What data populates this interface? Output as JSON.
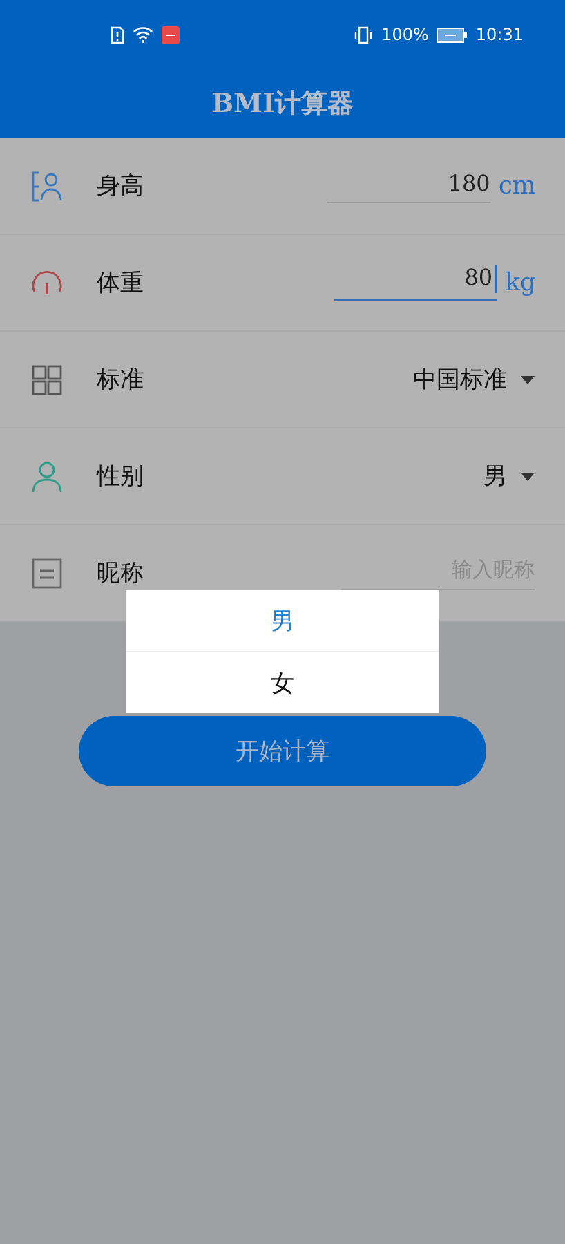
{
  "status_bar": {
    "battery": "100%",
    "time": "10:31"
  },
  "title": "BMI计算器",
  "rows": [
    {
      "kind": "input",
      "label": "身高",
      "value": "180",
      "unit": "cm",
      "focused": false
    },
    {
      "kind": "input",
      "label": "体重",
      "value": "80",
      "unit": "kg",
      "focused": true
    },
    {
      "kind": "select",
      "label": "标准",
      "value": "中国标准"
    },
    {
      "kind": "select",
      "label": "性别",
      "value": "男"
    },
    {
      "kind": "text",
      "label": "昵称",
      "placeholder": "输入昵称"
    }
  ],
  "dropdown": {
    "options": [
      {
        "label": "男",
        "selected": true
      },
      {
        "label": "女",
        "selected": false
      }
    ]
  },
  "button": "开始计算"
}
